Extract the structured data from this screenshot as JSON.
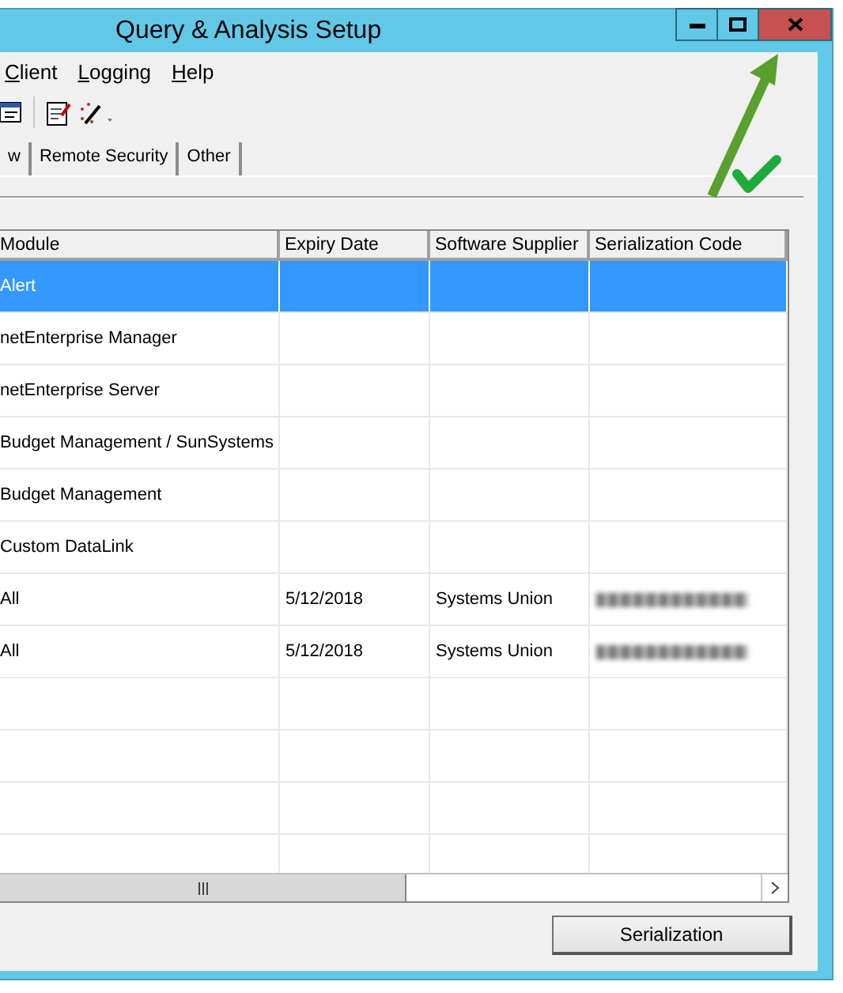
{
  "window": {
    "title": "Query & Analysis Setup"
  },
  "menu": [
    "Client",
    "Logging",
    "Help"
  ],
  "tabs": [
    {
      "label": "w",
      "selected": false
    },
    {
      "label": "Remote Security",
      "selected": false
    },
    {
      "label": "Other",
      "selected": false
    }
  ],
  "table": {
    "columns": [
      "Module",
      "Expiry Date",
      "Software Supplier",
      "Serialization Code"
    ],
    "rows": [
      {
        "module": "Alert",
        "expiry": "",
        "supplier": "",
        "serial_blurred": false,
        "selected": true
      },
      {
        "module": "netEnterprise Manager",
        "expiry": "",
        "supplier": "",
        "serial_blurred": false,
        "selected": false
      },
      {
        "module": "netEnterprise Server",
        "expiry": "",
        "supplier": "",
        "serial_blurred": false,
        "selected": false
      },
      {
        "module": "Budget Management / SunSystems",
        "expiry": "",
        "supplier": "",
        "serial_blurred": false,
        "selected": false
      },
      {
        "module": "Budget Management",
        "expiry": "",
        "supplier": "",
        "serial_blurred": false,
        "selected": false
      },
      {
        "module": "Custom DataLink",
        "expiry": "",
        "supplier": "",
        "serial_blurred": false,
        "selected": false
      },
      {
        "module": "All",
        "expiry": "5/12/2018",
        "supplier": "Systems Union",
        "serial_blurred": true,
        "selected": false
      },
      {
        "module": "All",
        "expiry": "5/12/2018",
        "supplier": "Systems Union",
        "serial_blurred": true,
        "selected": false
      },
      {
        "module": "",
        "expiry": "",
        "supplier": "",
        "serial_blurred": false,
        "selected": false
      },
      {
        "module": "",
        "expiry": "",
        "supplier": "",
        "serial_blurred": false,
        "selected": false
      },
      {
        "module": "",
        "expiry": "",
        "supplier": "",
        "serial_blurred": false,
        "selected": false
      },
      {
        "module": "",
        "expiry": "",
        "supplier": "",
        "serial_blurred": false,
        "selected": false
      }
    ]
  },
  "buttons": [
    "Serialization"
  ]
}
